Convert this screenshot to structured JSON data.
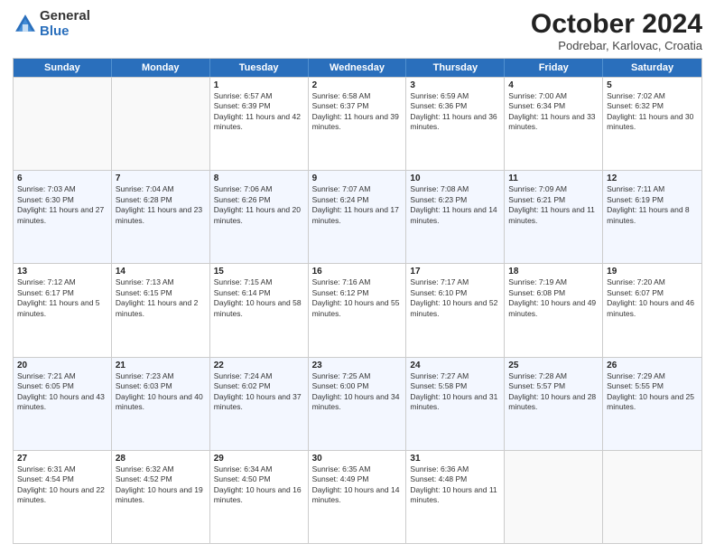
{
  "header": {
    "logo": {
      "general": "General",
      "blue": "Blue"
    },
    "title": "October 2024",
    "subtitle": "Podrebar, Karlovac, Croatia"
  },
  "days_of_week": [
    "Sunday",
    "Monday",
    "Tuesday",
    "Wednesday",
    "Thursday",
    "Friday",
    "Saturday"
  ],
  "rows": [
    [
      {
        "day": "",
        "info": "",
        "empty": true
      },
      {
        "day": "",
        "info": "",
        "empty": true
      },
      {
        "day": "1",
        "info": "Sunrise: 6:57 AM\nSunset: 6:39 PM\nDaylight: 11 hours and 42 minutes."
      },
      {
        "day": "2",
        "info": "Sunrise: 6:58 AM\nSunset: 6:37 PM\nDaylight: 11 hours and 39 minutes."
      },
      {
        "day": "3",
        "info": "Sunrise: 6:59 AM\nSunset: 6:36 PM\nDaylight: 11 hours and 36 minutes."
      },
      {
        "day": "4",
        "info": "Sunrise: 7:00 AM\nSunset: 6:34 PM\nDaylight: 11 hours and 33 minutes."
      },
      {
        "day": "5",
        "info": "Sunrise: 7:02 AM\nSunset: 6:32 PM\nDaylight: 11 hours and 30 minutes."
      }
    ],
    [
      {
        "day": "6",
        "info": "Sunrise: 7:03 AM\nSunset: 6:30 PM\nDaylight: 11 hours and 27 minutes."
      },
      {
        "day": "7",
        "info": "Sunrise: 7:04 AM\nSunset: 6:28 PM\nDaylight: 11 hours and 23 minutes."
      },
      {
        "day": "8",
        "info": "Sunrise: 7:06 AM\nSunset: 6:26 PM\nDaylight: 11 hours and 20 minutes."
      },
      {
        "day": "9",
        "info": "Sunrise: 7:07 AM\nSunset: 6:24 PM\nDaylight: 11 hours and 17 minutes."
      },
      {
        "day": "10",
        "info": "Sunrise: 7:08 AM\nSunset: 6:23 PM\nDaylight: 11 hours and 14 minutes."
      },
      {
        "day": "11",
        "info": "Sunrise: 7:09 AM\nSunset: 6:21 PM\nDaylight: 11 hours and 11 minutes."
      },
      {
        "day": "12",
        "info": "Sunrise: 7:11 AM\nSunset: 6:19 PM\nDaylight: 11 hours and 8 minutes."
      }
    ],
    [
      {
        "day": "13",
        "info": "Sunrise: 7:12 AM\nSunset: 6:17 PM\nDaylight: 11 hours and 5 minutes."
      },
      {
        "day": "14",
        "info": "Sunrise: 7:13 AM\nSunset: 6:15 PM\nDaylight: 11 hours and 2 minutes."
      },
      {
        "day": "15",
        "info": "Sunrise: 7:15 AM\nSunset: 6:14 PM\nDaylight: 10 hours and 58 minutes."
      },
      {
        "day": "16",
        "info": "Sunrise: 7:16 AM\nSunset: 6:12 PM\nDaylight: 10 hours and 55 minutes."
      },
      {
        "day": "17",
        "info": "Sunrise: 7:17 AM\nSunset: 6:10 PM\nDaylight: 10 hours and 52 minutes."
      },
      {
        "day": "18",
        "info": "Sunrise: 7:19 AM\nSunset: 6:08 PM\nDaylight: 10 hours and 49 minutes."
      },
      {
        "day": "19",
        "info": "Sunrise: 7:20 AM\nSunset: 6:07 PM\nDaylight: 10 hours and 46 minutes."
      }
    ],
    [
      {
        "day": "20",
        "info": "Sunrise: 7:21 AM\nSunset: 6:05 PM\nDaylight: 10 hours and 43 minutes."
      },
      {
        "day": "21",
        "info": "Sunrise: 7:23 AM\nSunset: 6:03 PM\nDaylight: 10 hours and 40 minutes."
      },
      {
        "day": "22",
        "info": "Sunrise: 7:24 AM\nSunset: 6:02 PM\nDaylight: 10 hours and 37 minutes."
      },
      {
        "day": "23",
        "info": "Sunrise: 7:25 AM\nSunset: 6:00 PM\nDaylight: 10 hours and 34 minutes."
      },
      {
        "day": "24",
        "info": "Sunrise: 7:27 AM\nSunset: 5:58 PM\nDaylight: 10 hours and 31 minutes."
      },
      {
        "day": "25",
        "info": "Sunrise: 7:28 AM\nSunset: 5:57 PM\nDaylight: 10 hours and 28 minutes."
      },
      {
        "day": "26",
        "info": "Sunrise: 7:29 AM\nSunset: 5:55 PM\nDaylight: 10 hours and 25 minutes."
      }
    ],
    [
      {
        "day": "27",
        "info": "Sunrise: 6:31 AM\nSunset: 4:54 PM\nDaylight: 10 hours and 22 minutes."
      },
      {
        "day": "28",
        "info": "Sunrise: 6:32 AM\nSunset: 4:52 PM\nDaylight: 10 hours and 19 minutes."
      },
      {
        "day": "29",
        "info": "Sunrise: 6:34 AM\nSunset: 4:50 PM\nDaylight: 10 hours and 16 minutes."
      },
      {
        "day": "30",
        "info": "Sunrise: 6:35 AM\nSunset: 4:49 PM\nDaylight: 10 hours and 14 minutes."
      },
      {
        "day": "31",
        "info": "Sunrise: 6:36 AM\nSunset: 4:48 PM\nDaylight: 10 hours and 11 minutes."
      },
      {
        "day": "",
        "info": "",
        "empty": true
      },
      {
        "day": "",
        "info": "",
        "empty": true
      }
    ]
  ]
}
